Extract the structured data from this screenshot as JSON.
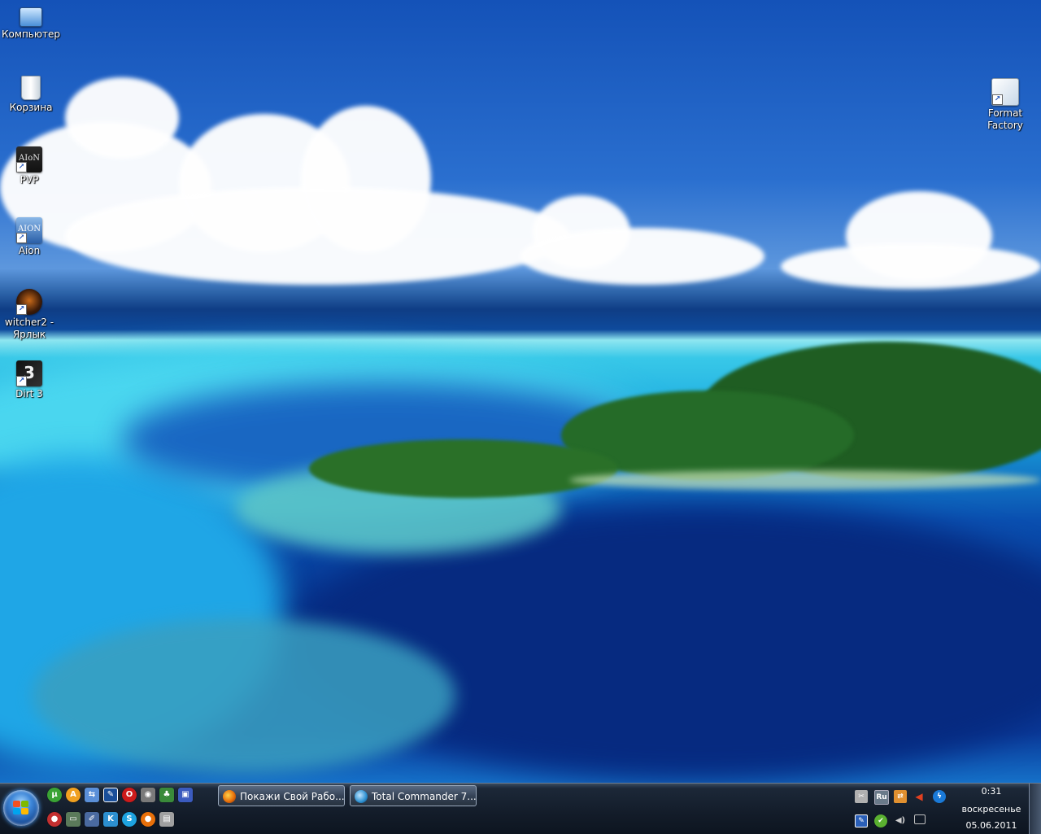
{
  "desktop": {
    "icons": [
      {
        "label": "Компьютер",
        "icon": "computer-icon"
      },
      {
        "label": "Корзина",
        "icon": "recycle-bin-icon"
      },
      {
        "label": "PVP",
        "icon": "aion-pvp-icon",
        "text": "AIoN"
      },
      {
        "label": "Aion",
        "icon": "aion-icon",
        "text": "AION"
      },
      {
        "label": "witcher2 - Ярлык",
        "icon": "witcher-icon"
      },
      {
        "label": "Dirt 3",
        "icon": "dirt3-icon",
        "text": "3"
      },
      {
        "label": "Format Factory",
        "icon": "format-factory-icon"
      }
    ]
  },
  "taskbar": {
    "start_icon": "windows-start-orb",
    "quick_launch": [
      {
        "name": "utorrent-icon",
        "glyph": "µ",
        "color": "#3aa335"
      },
      {
        "name": "aimp-icon",
        "glyph": "A",
        "color": "#f0a020"
      },
      {
        "name": "network-icon",
        "glyph": "⇆",
        "color": "#5a8fd8"
      },
      {
        "name": "notepad-icon",
        "glyph": "✎",
        "color": "#1a4f9a"
      },
      {
        "name": "opera-icon",
        "glyph": "O",
        "color": "#cc1b1b"
      },
      {
        "name": "eye-icon",
        "glyph": "◉",
        "color": "#7a7a7a"
      },
      {
        "name": "games-icon",
        "glyph": "♣",
        "color": "#3a8a3a"
      },
      {
        "name": "save-icon",
        "glyph": "▣",
        "color": "#3b5bbf"
      },
      {
        "name": "stop-icon",
        "glyph": "●",
        "color": "#c43030"
      },
      {
        "name": "folder-icon",
        "glyph": "▭",
        "color": "#5a7a5a"
      },
      {
        "name": "pen-icon",
        "glyph": "✐",
        "color": "#4a6aa0"
      },
      {
        "name": "kaspersky-icon",
        "glyph": "K",
        "color": "#2c8fd0"
      },
      {
        "name": "skype-icon",
        "glyph": "S",
        "color": "#1ea3e0"
      },
      {
        "name": "firefox-icon",
        "glyph": "●",
        "color": "#e8700a"
      },
      {
        "name": "total-commander-ql-icon",
        "glyph": "▤",
        "color": "#a0a0a0"
      }
    ],
    "tasks": [
      {
        "label": "Покажи Свой Рабо...",
        "icon": "firefox-icon",
        "color": "#e8700a"
      },
      {
        "label": "Total Commander 7....",
        "icon": "total-commander-icon",
        "color": "#2c8fd0"
      }
    ],
    "tray": {
      "language": "Ru",
      "icons_top": [
        {
          "name": "tray-tool-icon",
          "glyph": "✂",
          "color": "#b0b0b0"
        },
        {
          "name": "tray-language-icon",
          "glyph": "Ru",
          "color": "#6a7a8a"
        },
        {
          "name": "tray-network-icon",
          "glyph": "⇄",
          "color": "#e09030"
        },
        {
          "name": "tray-speaker-red-icon",
          "glyph": "◀",
          "color": "#d84020"
        },
        {
          "name": "tray-flash-icon",
          "glyph": "ϟ",
          "color": "#1a7ad8"
        }
      ],
      "icons_bottom": [
        {
          "name": "tray-notepad-icon",
          "glyph": "✎",
          "color": "#2a5fb8"
        },
        {
          "name": "tray-green-icon",
          "glyph": "✔",
          "color": "#5ab030"
        },
        {
          "name": "tray-volume-icon",
          "glyph": "◀)",
          "color": "#c0c0c0"
        },
        {
          "name": "tray-screen-icon",
          "glyph": "▭",
          "color": "#a0a0a0"
        }
      ]
    },
    "clock": {
      "time": "0:31",
      "day": "воскресенье",
      "date": "05.06.2011"
    }
  }
}
